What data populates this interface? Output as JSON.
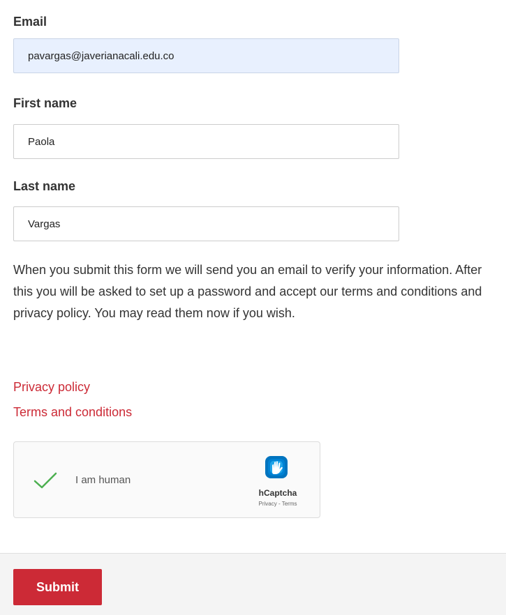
{
  "form": {
    "email": {
      "label": "Email",
      "value": "pavargas@javerianacali.edu.co"
    },
    "first_name": {
      "label": "First name",
      "value": "Paola"
    },
    "last_name": {
      "label": "Last name",
      "value": "Vargas"
    },
    "info_text": "When you submit this form we will send you an email to verify your information. After this you will be asked to set up a password and accept our terms and conditions and privacy policy. You may read them now if you wish.",
    "links": {
      "privacy": "Privacy policy",
      "terms": "Terms and conditions"
    },
    "captcha": {
      "label": "I am human",
      "brand": "hCaptcha",
      "sublinks": "Privacy - Terms",
      "checked": true,
      "check_color": "#4caf50",
      "check_icon": "checkmark-icon",
      "logo_icon": "hcaptcha-logo-icon"
    },
    "submit_label": "Submit"
  },
  "colors": {
    "accent": "#cc2a36",
    "autofill_background": "#e8f0fe",
    "footer_background": "#f4f4f4"
  }
}
